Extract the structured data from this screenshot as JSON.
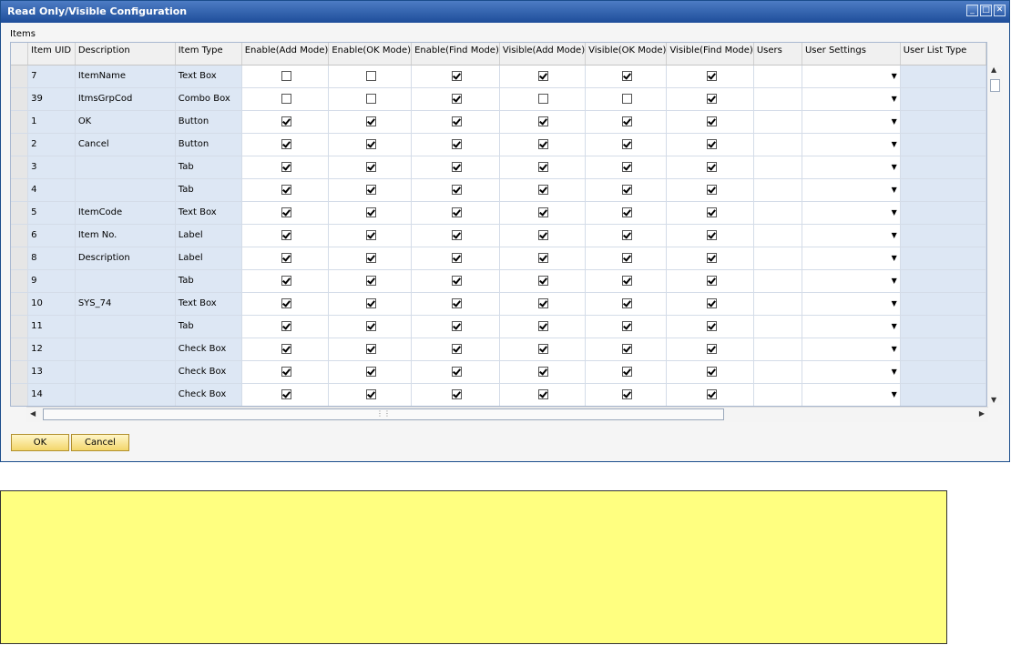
{
  "window": {
    "title": "Read Only/Visible Configuration"
  },
  "section_label": "Items",
  "columns": [
    "Item UID",
    "Description",
    "Item Type",
    "Enable(Add Mode)",
    "Enable(OK Mode)",
    "Enable(Find Mode)",
    "Visible(Add Mode)",
    "Visible(OK Mode)",
    "Visible(Find Mode)",
    "Users",
    "User Settings",
    "User List Type"
  ],
  "rows": [
    {
      "uid": "7",
      "desc": "ItemName",
      "type": "Text Box",
      "checks": [
        false,
        false,
        true,
        true,
        true,
        true
      ]
    },
    {
      "uid": "39",
      "desc": "ItmsGrpCod",
      "type": "Combo Box",
      "checks": [
        false,
        false,
        true,
        false,
        false,
        true
      ]
    },
    {
      "uid": "1",
      "desc": "OK",
      "type": "Button",
      "checks": [
        true,
        true,
        true,
        true,
        true,
        true
      ]
    },
    {
      "uid": "2",
      "desc": "Cancel",
      "type": "Button",
      "checks": [
        true,
        true,
        true,
        true,
        true,
        true
      ]
    },
    {
      "uid": "3",
      "desc": "",
      "type": "Tab",
      "checks": [
        true,
        true,
        true,
        true,
        true,
        true
      ]
    },
    {
      "uid": "4",
      "desc": "",
      "type": "Tab",
      "checks": [
        true,
        true,
        true,
        true,
        true,
        true
      ]
    },
    {
      "uid": "5",
      "desc": "ItemCode",
      "type": "Text Box",
      "checks": [
        true,
        true,
        true,
        true,
        true,
        true
      ]
    },
    {
      "uid": "6",
      "desc": "Item No.",
      "type": "Label",
      "checks": [
        true,
        true,
        true,
        true,
        true,
        true
      ]
    },
    {
      "uid": "8",
      "desc": "Description",
      "type": "Label",
      "checks": [
        true,
        true,
        true,
        true,
        true,
        true
      ]
    },
    {
      "uid": "9",
      "desc": "",
      "type": "Tab",
      "checks": [
        true,
        true,
        true,
        true,
        true,
        true
      ]
    },
    {
      "uid": "10",
      "desc": "SYS_74",
      "type": "Text Box",
      "checks": [
        true,
        true,
        true,
        true,
        true,
        true
      ]
    },
    {
      "uid": "11",
      "desc": "",
      "type": "Tab",
      "checks": [
        true,
        true,
        true,
        true,
        true,
        true
      ]
    },
    {
      "uid": "12",
      "desc": "",
      "type": "Check Box",
      "checks": [
        true,
        true,
        true,
        true,
        true,
        true
      ]
    },
    {
      "uid": "13",
      "desc": "",
      "type": "Check Box",
      "checks": [
        true,
        true,
        true,
        true,
        true,
        true
      ]
    },
    {
      "uid": "14",
      "desc": "",
      "type": "Check Box",
      "checks": [
        true,
        true,
        true,
        true,
        true,
        true
      ]
    }
  ],
  "buttons": {
    "ok": "OK",
    "cancel": "Cancel"
  },
  "icons": {
    "dropdown": "dropdown-arrow-icon",
    "minimize": "minimize-icon",
    "maximize": "maximize-icon",
    "close": "close-icon"
  },
  "colors": {
    "title_bar": "#1e4d9a",
    "editable_column": "#dde7f4",
    "button": "#f3d66b",
    "note_background": "#ffff80"
  }
}
